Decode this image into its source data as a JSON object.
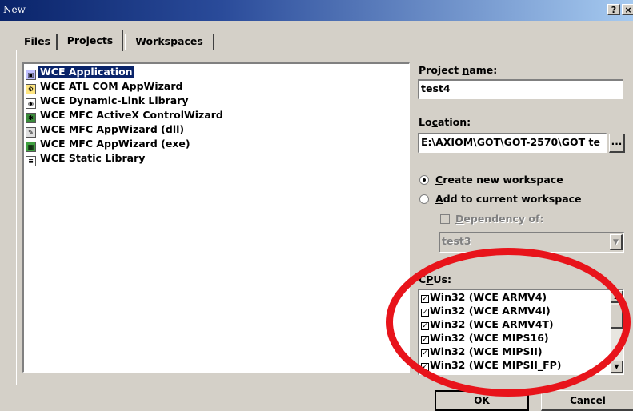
{
  "window": {
    "title": "New",
    "help_label": "?",
    "close_label": "×"
  },
  "tabs": [
    {
      "label": "Files"
    },
    {
      "label": "Projects"
    },
    {
      "label": "Workspaces"
    }
  ],
  "projects_list": {
    "items": [
      {
        "label": "WCE Application",
        "selected": true,
        "icon": "application-icon"
      },
      {
        "label": "WCE ATL COM AppWizard",
        "icon": "atl-com-icon"
      },
      {
        "label": "WCE Dynamic-Link Library",
        "icon": "dll-icon"
      },
      {
        "label": "WCE MFC ActiveX ControlWizard",
        "icon": "activex-icon"
      },
      {
        "label": "WCE MFC AppWizard (dll)",
        "icon": "mfc-dll-icon"
      },
      {
        "label": "WCE MFC AppWizard (exe)",
        "icon": "mfc-exe-icon"
      },
      {
        "label": "WCE Static Library",
        "icon": "static-library-icon"
      }
    ]
  },
  "project_name": {
    "label_pre": "Project ",
    "label_access": "n",
    "label_post": "ame:",
    "value": "test4"
  },
  "location": {
    "label_pre": "Lo",
    "label_access": "c",
    "label_post": "ation:",
    "value": "E:\\AXIOM\\GOT\\GOT-2570\\GOT te",
    "browse_label": "..."
  },
  "workspace_options": {
    "create_new_pre": "",
    "create_new_access": "C",
    "create_new_post": "reate new workspace",
    "add_current_pre": "",
    "add_current_access": "A",
    "add_current_post": "dd to current workspace",
    "dependency_pre": "",
    "dependency_access": "D",
    "dependency_post": "ependency of:",
    "dependency_value": "test3",
    "selected": "create_new"
  },
  "cpus": {
    "label_pre": "C",
    "label_access": "P",
    "label_post": "Us:",
    "check_mark": "✓",
    "items": [
      {
        "label": "Win32 (WCE ARMV4)",
        "checked": true
      },
      {
        "label": "Win32 (WCE ARMV4I)",
        "checked": true
      },
      {
        "label": "Win32 (WCE ARMV4T)",
        "checked": true
      },
      {
        "label": "Win32 (WCE MIPS16)",
        "checked": true
      },
      {
        "label": "Win32 (WCE MIPSII)",
        "checked": true
      },
      {
        "label": "Win32 (WCE MIPSII_FP)",
        "checked": true
      }
    ]
  },
  "footer_buttons": {
    "ok_label": "OK",
    "cancel_label": "Cancel"
  },
  "colors": {
    "annotation_circle": "#e8141b",
    "selection": "#0a246a",
    "dialog_bg": "#d4d0c8"
  }
}
